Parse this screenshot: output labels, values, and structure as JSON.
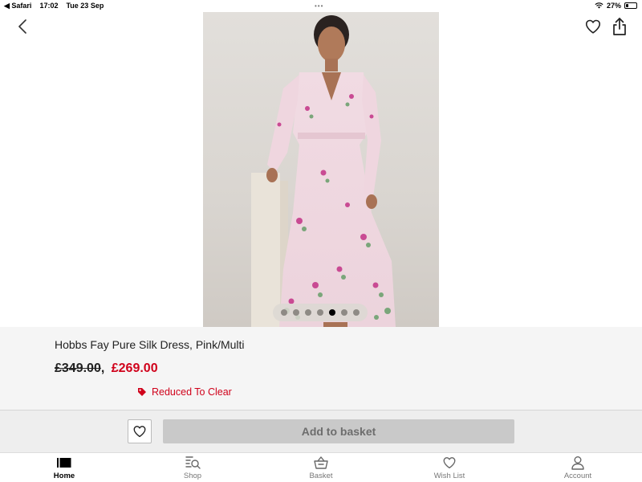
{
  "status_bar": {
    "app": "◀ Safari",
    "time": "17:02",
    "date": "Tue 23 Sep",
    "battery": "27%",
    "battery_level": 0.27
  },
  "product": {
    "title": "Hobbs Fay Pure Silk Dress, Pink/Multi",
    "price_old": "£349.00",
    "price_separator": ",",
    "price_new": "£269.00",
    "promo_label": "Reduced To Clear",
    "image_count": 7,
    "active_image": 5
  },
  "actions": {
    "add_to_basket": "Add to basket"
  },
  "tabs": [
    {
      "label": "Home",
      "icon": "home-icon",
      "active": true
    },
    {
      "label": "Shop",
      "icon": "shop-search-icon",
      "active": false
    },
    {
      "label": "Basket",
      "icon": "basket-icon",
      "active": false
    },
    {
      "label": "Wish List",
      "icon": "heart-icon",
      "active": false
    },
    {
      "label": "Account",
      "icon": "account-icon",
      "active": false
    }
  ],
  "colors": {
    "sale_red": "#d0021b",
    "panel_bg": "#f5f5f5",
    "button_disabled": "#c9c9c9"
  }
}
